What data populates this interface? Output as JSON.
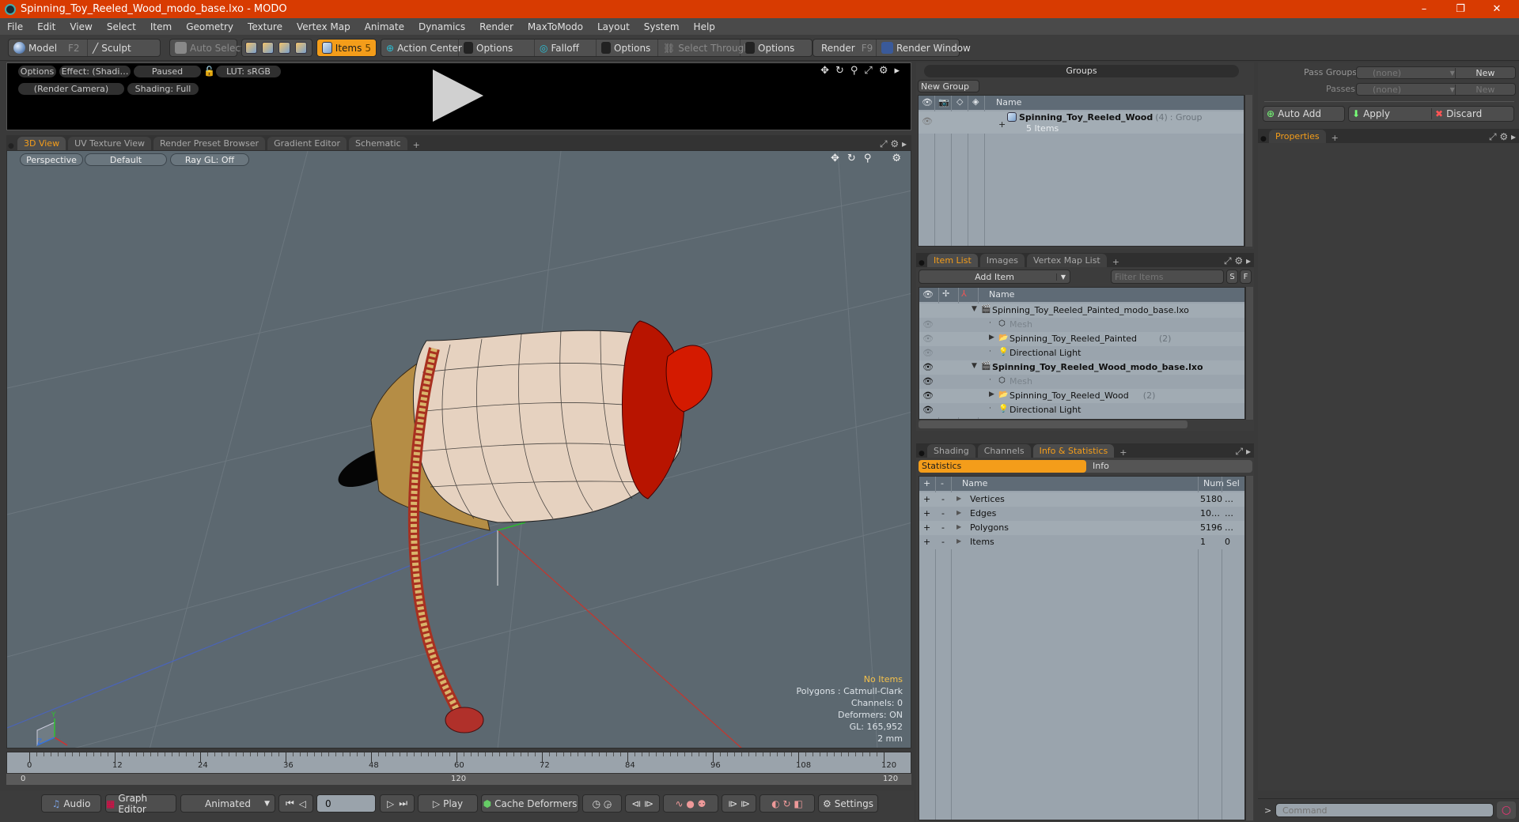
{
  "window": {
    "title": "Spinning_Toy_Reeled_Wood_modo_base.lxo - MODO",
    "controls": {
      "minimize": "–",
      "restore": "❐",
      "close": "✕"
    }
  },
  "menu": [
    "File",
    "Edit",
    "View",
    "Select",
    "Item",
    "Geometry",
    "Texture",
    "Vertex Map",
    "Animate",
    "Dynamics",
    "Render",
    "MaxToModo",
    "Layout",
    "System",
    "Help"
  ],
  "toolbar": {
    "model": "Model",
    "model_key": "F2",
    "sculpt": "Sculpt",
    "auto_select": "Auto Select",
    "items": "Items",
    "items_key": "5",
    "action_center": "Action Center",
    "options1": "Options",
    "falloff": "Falloff",
    "options2": "Options",
    "select_through": "Select Through",
    "options3": "Options",
    "render": "Render",
    "render_key": "F9",
    "render_window": "Render Window"
  },
  "render_preview": {
    "options": "Options",
    "effect": "Effect: (Shadi…",
    "paused": "Paused",
    "lut": "LUT: sRGB",
    "camera": "(Render Camera)",
    "shading": "Shading: Full"
  },
  "viewport_tabs": [
    {
      "label": "3D View",
      "active": true
    },
    {
      "label": "UV Texture View",
      "active": false
    },
    {
      "label": "Render Preset Browser",
      "active": false
    },
    {
      "label": "Gradient Editor",
      "active": false
    },
    {
      "label": "Schematic",
      "active": false
    }
  ],
  "viewport": {
    "projection": "Perspective",
    "style": "Default",
    "raygl": "Ray GL: Off",
    "info": {
      "selection": "No Items",
      "polygons": "Polygons : Catmull-Clark",
      "channels": "Channels: 0",
      "deformers": "Deformers: ON",
      "gl": "GL: 165,952",
      "scale": "2 mm"
    },
    "axis_labels": {
      "x": "X",
      "y": "Y",
      "z": "Z"
    }
  },
  "timeline": {
    "ticks": [
      "0",
      "12",
      "24",
      "36",
      "48",
      "60",
      "72",
      "84",
      "96",
      "108",
      "120"
    ],
    "range_start": "0",
    "range_mid": "120",
    "range_end": "120"
  },
  "transport": {
    "audio": "Audio",
    "graph_editor": "Graph Editor",
    "animated": "Animated",
    "frame": "0",
    "play": "Play",
    "cache_deformers": "Cache Deformers",
    "settings": "Settings"
  },
  "groups": {
    "title": "Groups",
    "new_group": "New Group",
    "name_col": "Name",
    "items": [
      {
        "name": "Spinning_Toy_Reeled_Wood",
        "count": "(4)",
        "type": ": Group",
        "sub": "5 Items"
      }
    ]
  },
  "passes": {
    "pass_groups_label": "Pass Groups",
    "pass_groups_value": "(none)",
    "new1": "New",
    "passes_label": "Passes",
    "passes_value": "(none)",
    "new2": "New",
    "auto_add": "Auto Add",
    "apply": "Apply",
    "discard": "Discard"
  },
  "properties": {
    "tab": "Properties"
  },
  "item_list": {
    "tabs": [
      {
        "label": "Item List",
        "active": true
      },
      {
        "label": "Images",
        "active": false
      },
      {
        "label": "Vertex Map List",
        "active": false
      }
    ],
    "add_item": "Add Item",
    "filter_placeholder": "Filter Items",
    "s": "S",
    "f": "F",
    "name_col": "Name",
    "rows": [
      {
        "name": "Spinning_Toy_Reeled_Painted_modo_base.lxo",
        "count": "",
        "kind": "scene",
        "level": 0,
        "bold": false,
        "dim": false,
        "eye": "none"
      },
      {
        "name": "Mesh",
        "count": "",
        "kind": "mesh",
        "level": 1,
        "bold": false,
        "dim": true,
        "eye": "faded"
      },
      {
        "name": "Spinning_Toy_Reeled_Painted",
        "count": "(2)",
        "kind": "group",
        "level": 1,
        "bold": false,
        "dim": false,
        "eye": "faded"
      },
      {
        "name": "Directional Light",
        "count": "",
        "kind": "light",
        "level": 1,
        "bold": false,
        "dim": false,
        "eye": "faded"
      },
      {
        "name": "Spinning_Toy_Reeled_Wood_modo_base.lxo",
        "count": "",
        "kind": "scene",
        "level": 0,
        "bold": true,
        "dim": false,
        "eye": "on"
      },
      {
        "name": "Mesh",
        "count": "",
        "kind": "mesh",
        "level": 1,
        "bold": false,
        "dim": true,
        "eye": "on"
      },
      {
        "name": "Spinning_Toy_Reeled_Wood",
        "count": "(2)",
        "kind": "group",
        "level": 1,
        "bold": false,
        "dim": false,
        "eye": "on"
      },
      {
        "name": "Directional Light",
        "count": "",
        "kind": "light",
        "level": 1,
        "bold": false,
        "dim": false,
        "eye": "on"
      }
    ]
  },
  "info_panel": {
    "tabs": [
      {
        "label": "Shading",
        "active": false
      },
      {
        "label": "Channels",
        "active": false
      },
      {
        "label": "Info & Statistics",
        "active": true
      }
    ],
    "subtabs": {
      "statistics": "Statistics",
      "info": "Info"
    },
    "columns": {
      "plus": "+",
      "minus": "-",
      "name": "Name",
      "num": "Num",
      "sel": "Sel"
    },
    "rows": [
      {
        "name": "Vertices",
        "num": "5180",
        "sel": "…"
      },
      {
        "name": "Edges",
        "num": "10…",
        "sel": "…"
      },
      {
        "name": "Polygons",
        "num": "5196",
        "sel": "…"
      },
      {
        "name": "Items",
        "num": "1",
        "sel": "0"
      }
    ]
  },
  "command": {
    "prompt": ">",
    "placeholder": "Command"
  }
}
